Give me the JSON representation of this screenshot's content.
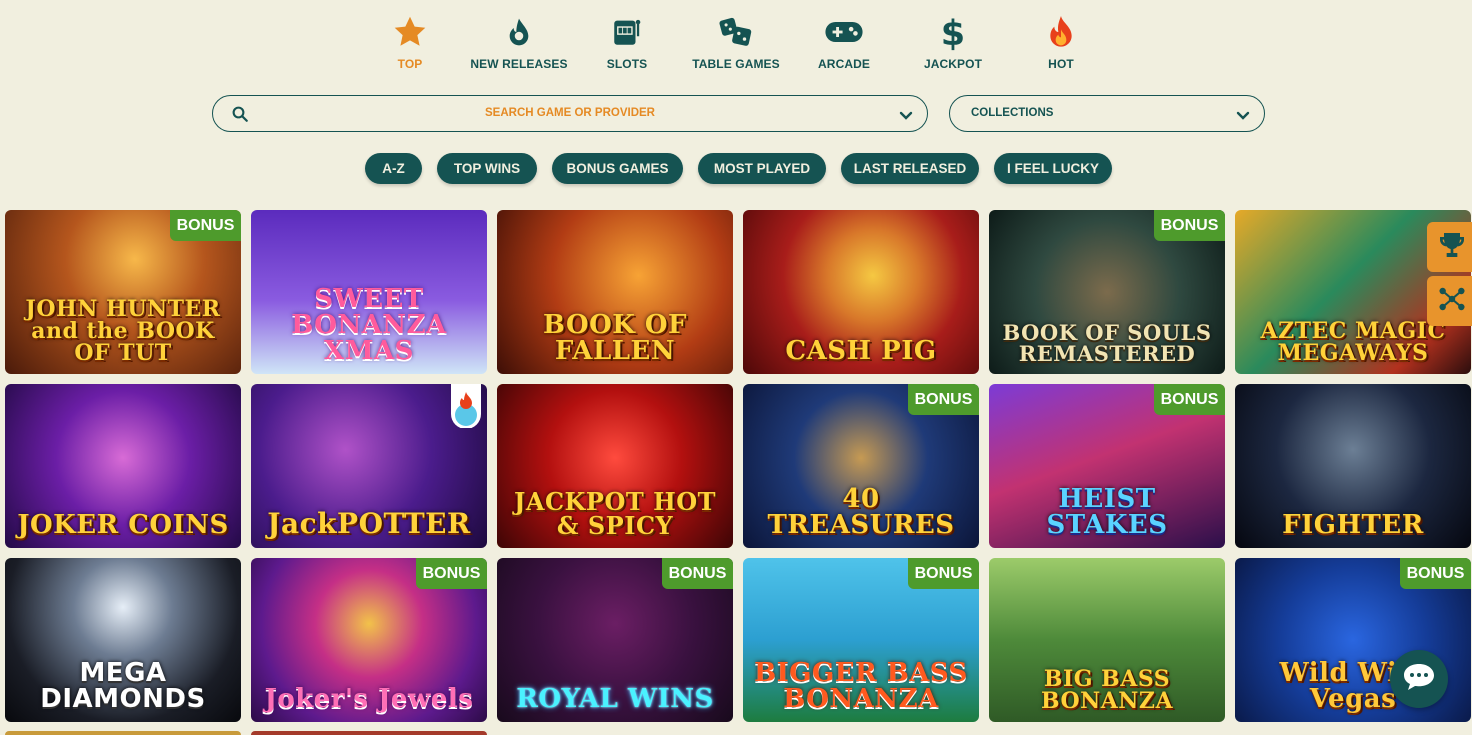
{
  "categories": [
    {
      "label": "TOP",
      "icon": "star-icon",
      "active": true
    },
    {
      "label": "NEW RELEASES",
      "icon": "drop-icon"
    },
    {
      "label": "SLOTS",
      "icon": "slot-machine-icon"
    },
    {
      "label": "TABLE GAMES",
      "icon": "dice-icon"
    },
    {
      "label": "ARCADE",
      "icon": "gamepad-icon"
    },
    {
      "label": "JACKPOT",
      "icon": "dollar-icon"
    },
    {
      "label": "HOT",
      "icon": "flame-icon"
    }
  ],
  "search": {
    "placeholder": "SEARCH GAME OR PROVIDER"
  },
  "collections": {
    "label": "COLLECTIONS"
  },
  "filters": [
    "A-Z",
    "TOP WINS",
    "BONUS GAMES",
    "MOST PLAYED",
    "LAST RELEASED",
    "I FEEL LUCKY"
  ],
  "badge_label": "BONUS",
  "games": [
    {
      "title": "JOHN HUNTER and the BOOK OF TUT",
      "bonus": true
    },
    {
      "title": "SWEET BONANZA XMAS",
      "bonus": false
    },
    {
      "title": "BOOK OF FALLEN",
      "bonus": false
    },
    {
      "title": "CASH PIG",
      "bonus": false
    },
    {
      "title": "BOOK OF SOULS REMASTERED",
      "bonus": true
    },
    {
      "title": "AZTEC MAGIC MEGAWAYS",
      "bonus": false
    },
    {
      "title": "JOKER COINS",
      "bonus": false
    },
    {
      "title": "JackPOTTER",
      "bonus": false,
      "hot": true
    },
    {
      "title": "JACKPOT HOT & SPICY",
      "bonus": false
    },
    {
      "title": "40 TREASURES",
      "bonus": true
    },
    {
      "title": "HEIST STAKES",
      "bonus": true
    },
    {
      "title": "FIGHTER",
      "bonus": false
    },
    {
      "title": "MEGA DIAMONDS",
      "bonus": false
    },
    {
      "title": "Joker's Jewels",
      "bonus": true
    },
    {
      "title": "ROYAL WINS",
      "bonus": true
    },
    {
      "title": "BIGGER BASS BONANZA",
      "bonus": true
    },
    {
      "title": "BIG BASS BONANZA",
      "bonus": false
    },
    {
      "title": "Wild Wild Vegas",
      "bonus": true
    }
  ],
  "side_buttons": [
    "trophy-icon",
    "network-icon"
  ],
  "chat": {
    "icon": "chat-bubble-icon"
  },
  "colors": {
    "brand": "#155352",
    "accent": "#e58a24",
    "background": "#f1efdf",
    "bonus": "#4e9b2c"
  }
}
